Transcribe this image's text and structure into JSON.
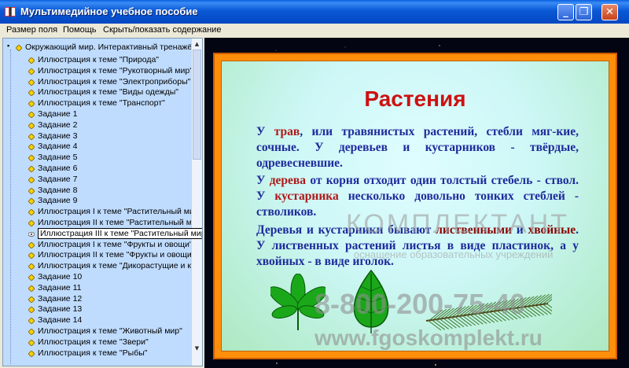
{
  "window": {
    "title": "Мультимедийное учебное пособие",
    "minimize": "_",
    "restore": "❐",
    "close": "✕"
  },
  "menu": [
    {
      "label": "Размер поля"
    },
    {
      "label": "Помощь"
    },
    {
      "label": "Скрыть/показать содержание"
    }
  ],
  "tree": {
    "root": "Окружающий мир. Интерактивный тренажё",
    "items": [
      "Иллюстрация к теме \"Природа\"",
      "Иллюстрация к теме \"Рукотворный мир\"",
      "Иллюстрация к теме \"Электроприборы\"",
      "Иллюстрация к теме \"Виды одежды\"",
      "Иллюстрация к теме \"Транспорт\"",
      "Задание 1",
      "Задание 2",
      "Задание 3",
      "Задание 4",
      "Задание 5",
      "Задание 6",
      "Задание 7",
      "Задание 8",
      "Задание 9",
      "Иллюстрация I к теме \"Растительный ми",
      "Иллюстрация II к теме \"Растительный ми",
      "Иллюстрация III к теме \"Растительный мир\"",
      "Иллюстрация I к теме \"Фрукты и овощи\"",
      "Иллюстрация II к теме \"Фрукты и овощи",
      "Иллюстрация к теме \"Дикорастущие и ку",
      "Задание 10",
      "Задание 11",
      "Задание 12",
      "Задание 13",
      "Задание 14",
      "Иллюстрация к теме \"Животный мир\"",
      "Иллюстрация к теме \"Звери\"",
      "Иллюстрация к теме \"Рыбы\""
    ],
    "selected_index": 16
  },
  "slide": {
    "title": "Растения",
    "p1": [
      "У ",
      "трав",
      ", или травянистых растений, стебли мяг-кие, сочные. У деревьев и кустарников - твёрдые, одревесневшие."
    ],
    "p2": [
      "У ",
      "дерева",
      " от корня отходит один толстый стебель - ствол. У ",
      "кустарника",
      " несколько довольно тонких стеблей - стволиков."
    ],
    "p3": [
      "Деревья и кустарники бывают ",
      "лиственными",
      " и ",
      "хвойные",
      ". У лиственных растений листья в виде пластинок, а у хвойных - в виде иголок."
    ]
  },
  "watermark": {
    "brand": "КОМПЛЕКТАНТ",
    "tagline": "оснащение образовательных учреждений",
    "phone": "8-800-200-75-40",
    "url": "www.fgoskomplekt.ru"
  },
  "colors": {
    "accent_red": "#cc1111",
    "text_blue": "#1e2b9c",
    "frame_orange": "#ff8f0a",
    "tree_bg": "#bfdcff"
  }
}
